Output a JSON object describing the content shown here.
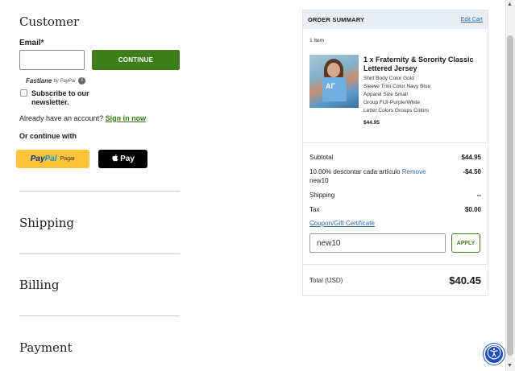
{
  "customer": {
    "title": "Customer",
    "email_label": "Email*",
    "email_value": "",
    "continue_label": "CONTINUE",
    "fastlane_label": "Fastlane",
    "fastlane_by": "by PayPal",
    "subscribe_label": "Subscribe to our newsletter.",
    "already_text": "Already have an account?",
    "sign_in_label": "Sign in now",
    "or_continue": "Or continue with",
    "paypal_label_a": "Pay",
    "paypal_label_b": "Pal",
    "paypal_pagar": "Pagar",
    "applepay_label": "Pay"
  },
  "sections": {
    "shipping": "Shipping",
    "billing": "Billing",
    "payment": "Payment"
  },
  "summary": {
    "title": "ORDER SUMMARY",
    "edit_cart": "Edit Cart",
    "item_count": "1 Item",
    "item_title": "1 x Fraternity & Sorority Classic Lettered Jersey",
    "item_attrs": [
      "Shirt Body Color Gold",
      "Sleeve Trim Color Navy Blue",
      "Apparel Size Small",
      "Group FIJI-Purple/White",
      "Letter Colors Groups Colors"
    ],
    "item_price": "$44.95",
    "subtotal_label": "Subtotal",
    "subtotal_value": "$44.95",
    "discount_label": "10.00% descontar cada artículo",
    "discount_remove": "Remove",
    "discount_code": "new10",
    "discount_value": "-$4.50",
    "shipping_label": "Shipping",
    "shipping_value": "--",
    "tax_label": "Tax",
    "tax_value": "$0.00",
    "coupon_link": "Coupon/Gift Certificate",
    "coupon_value": "new10",
    "apply_label": "APPLY",
    "total_label": "Total (USD)",
    "total_value": "$40.45"
  },
  "colors": {
    "primary_green": "#3f7d1a",
    "link_blue": "#2e6da4",
    "paypal_yellow": "#ffc439",
    "summary_header_bg": "#e8eef4",
    "a11y_blue": "#1d4fbf"
  },
  "icons": {
    "info": "info-icon",
    "apple": "apple-icon",
    "accessibility": "accessibility-icon"
  }
}
